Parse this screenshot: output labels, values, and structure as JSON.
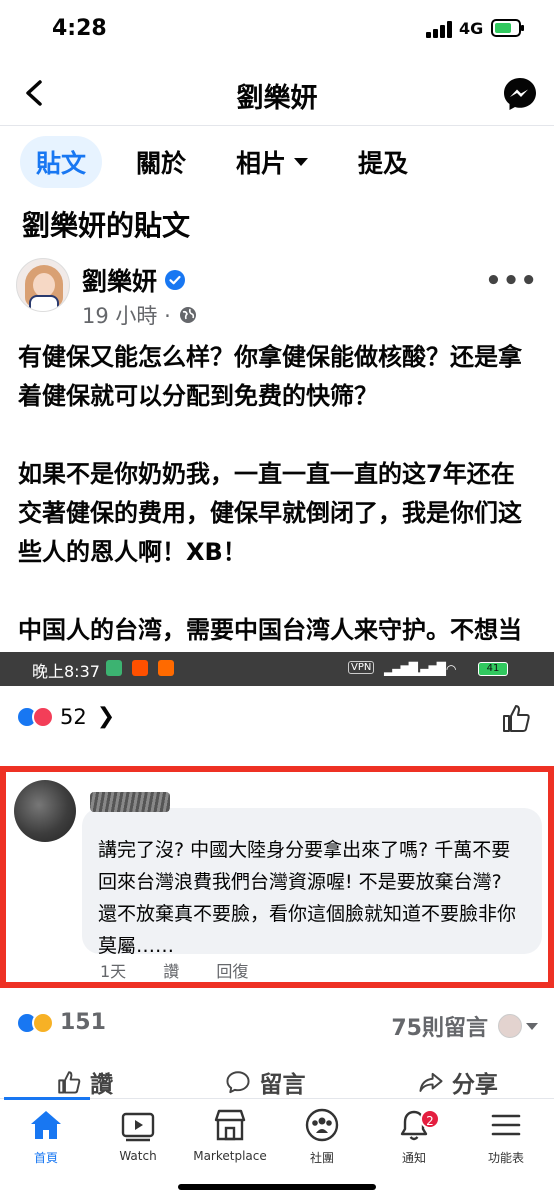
{
  "status_bar": {
    "time": "4:28",
    "network": "4G"
  },
  "header": {
    "title": "劉樂妍"
  },
  "tabs": [
    {
      "label": "貼文"
    },
    {
      "label": "關於"
    },
    {
      "label": "相片"
    },
    {
      "label": "提及"
    }
  ],
  "section_title": "劉樂妍的貼文",
  "post": {
    "author": "劉樂妍",
    "time": "19 小時 ·",
    "paragraphs": [
      "有健保又能怎么样？你拿健保能做核酸？还是拿着健保就可以分配到免费的快筛？",
      "如果不是你奶奶我，一直一直一直的这7年还在交著健保的费用，健保早就倒闭了，我是你们这些人的恩人啊！XB！",
      "中国人的台湾，需要中国台湾人来守护。不想当中国人的，那你滚出台湾啊！！"
    ]
  },
  "embedded": {
    "status": {
      "time": "晚上8:37",
      "vpn": "VPN",
      "battery": "41"
    },
    "reaction_count": "52",
    "comment_text": "講完了沒? 中國大陸身分要拿出來了嗎? 千萬不要回來台灣浪費我們台灣資源喔! 不是要放棄台灣? 還不放棄真不要臉，看你這個臉就知道不要臉非你莫屬……",
    "comment_actions": [
      "1天",
      "讚",
      "回復"
    ]
  },
  "stats": {
    "reactions": "151",
    "comments": "75則留言"
  },
  "actions": {
    "like": "讚",
    "comment": "留言",
    "share": "分享"
  },
  "nav": {
    "home": "首頁",
    "watch": "Watch",
    "marketplace": "Marketplace",
    "groups": "社團",
    "notifications": "通知",
    "notifications_badge": "2",
    "menu": "功能表"
  },
  "colors": {
    "accent": "#1877f2",
    "highlight_border": "#ee3124",
    "badge": "#e41e3f"
  }
}
